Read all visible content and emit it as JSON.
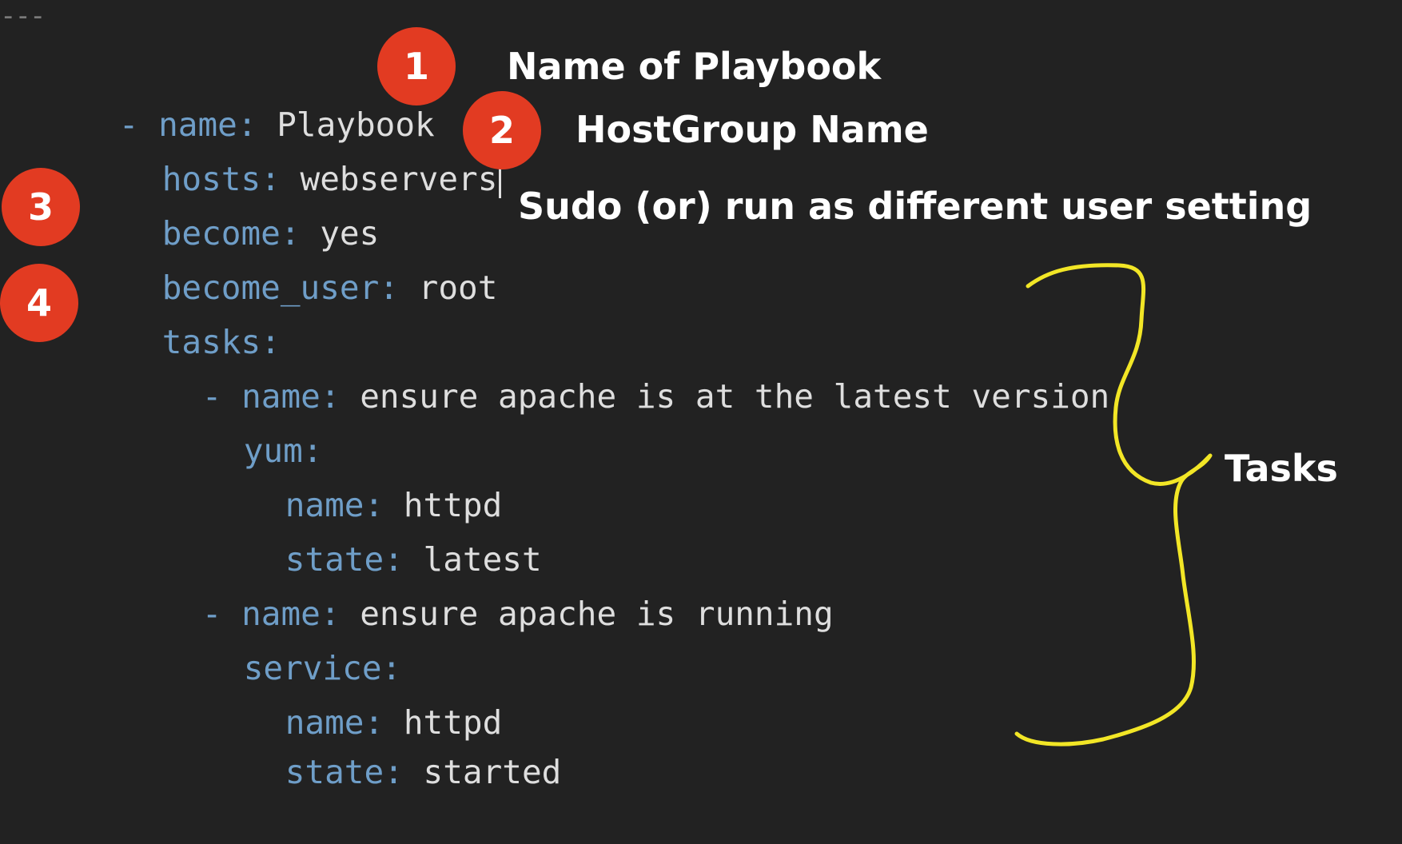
{
  "editor": {
    "doc_start": "---",
    "lines": [
      {
        "dash": "- ",
        "key": "name",
        "value": "Playbook"
      },
      {
        "key": "hosts",
        "value": "webservers"
      },
      {
        "key": "become",
        "value": "yes"
      },
      {
        "key": "become_user",
        "value": "root"
      },
      {
        "key": "tasks",
        "value": ""
      },
      {
        "dash": "- ",
        "key": "name",
        "value": "ensure apache is at the latest version"
      },
      {
        "key": "yum",
        "value": ""
      },
      {
        "key": "name",
        "value": "httpd"
      },
      {
        "key": "state",
        "value": "latest"
      },
      {
        "dash": "- ",
        "key": "name",
        "value": "ensure apache is running"
      },
      {
        "key": "service",
        "value": ""
      },
      {
        "key": "name",
        "value": "httpd"
      },
      {
        "key": "state",
        "value": "started"
      }
    ]
  },
  "annotations": {
    "badges": [
      "1",
      "2",
      "3",
      "4"
    ],
    "labels": {
      "name_of_playbook": "Name of Playbook",
      "hostgroup_name": "HostGroup Name",
      "sudo_setting": "Sudo (or) run as different user setting",
      "tasks": "Tasks"
    },
    "badge_color": "#e23b22",
    "brace_color": "#f2e626",
    "key_color": "#6f9ec8",
    "background": "#222222"
  }
}
